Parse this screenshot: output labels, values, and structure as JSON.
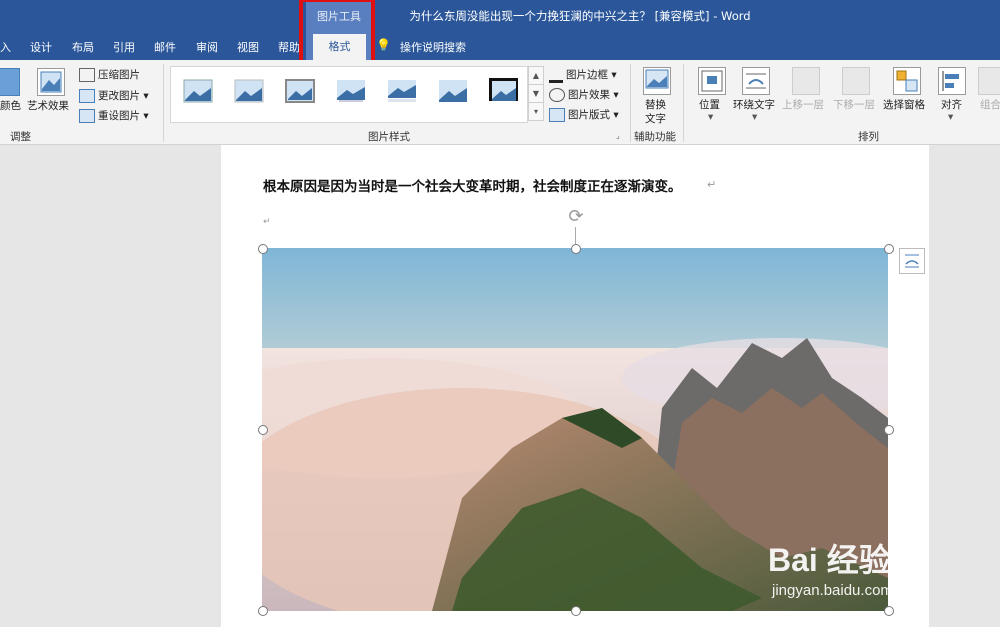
{
  "window": {
    "title": "为什么东周没能出现一个力挽狂澜的中兴之主？ [兼容模式] - Word",
    "context_tab_group": "图片工具"
  },
  "tabs": [
    "入",
    "设计",
    "布局",
    "引用",
    "邮件",
    "审阅",
    "视图",
    "帮助"
  ],
  "active_tab": "格式",
  "tell_me": {
    "label": "操作说明搜索",
    "icon": "lightbulb-icon"
  },
  "ribbon": {
    "adjust": {
      "color_label": "颜色",
      "artistic_label": "艺术效果",
      "compress_label": "压缩图片",
      "change_label": "更改图片",
      "reset_label": "重设图片",
      "group_label": "调整"
    },
    "styles": {
      "border_label": "图片边框",
      "effects_label": "图片效果",
      "layout_label": "图片版式",
      "group_label": "图片样式"
    },
    "accessibility": {
      "alt_text_label_1": "替换",
      "alt_text_label_2": "文字",
      "group_label": "辅助功能"
    },
    "arrange": {
      "position_label": "位置",
      "wrap_label": "环绕文字",
      "forward_label": "上移一层",
      "backward_label": "下移一层",
      "pane_label": "选择窗格",
      "align_label": "对齐",
      "group_obj_label": "组合",
      "group_label": "排列"
    }
  },
  "document": {
    "paragraph": "根本原因是因为当时是一个社会大变革时期，社会制度正在逐渐演变。",
    "paragraph_mark": "↵",
    "empty_paragraph_mark": "↵",
    "picture_alt": "黄山云海风景图片"
  },
  "watermark": {
    "brand": "Bai 经验",
    "url": "jingyan.baidu.com"
  },
  "colors": {
    "title_bar": "#2b579a",
    "context_group": "#5a7fc0",
    "highlight": "#e01010",
    "ribbon_bg": "#f3f3f3"
  }
}
